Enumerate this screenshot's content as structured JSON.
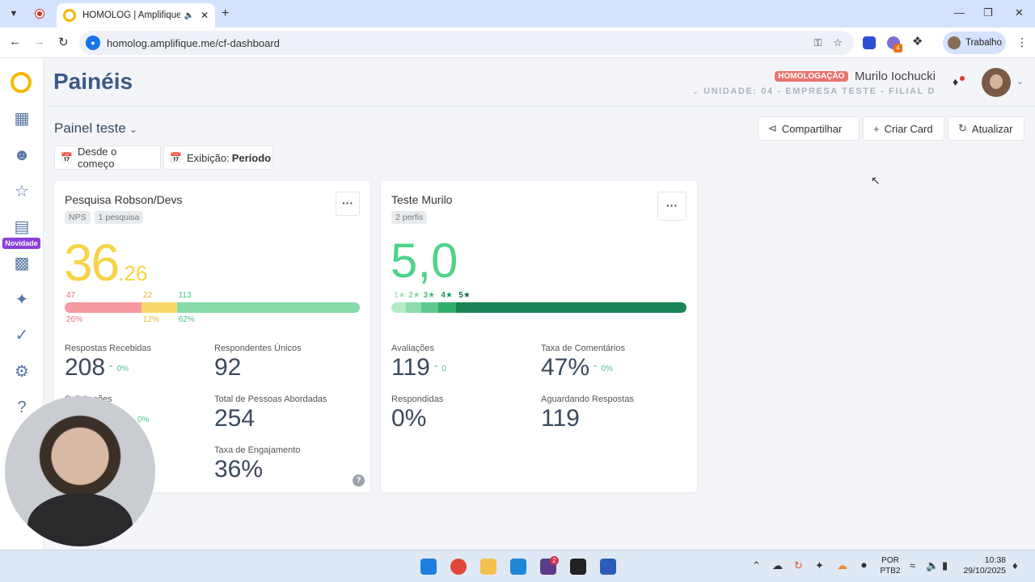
{
  "browser": {
    "tab_title": "HOMOLOG | Amplifique.me",
    "url": "homolog.amplifique.me/cf-dashboard",
    "profile_label": "Trabalho",
    "extension_badge": "4"
  },
  "sidebar": {
    "novidade_label": "Novidade"
  },
  "header": {
    "title": "Painéis",
    "env_badge": "HOMOLOGAÇÃO",
    "user_name": "Murilo Iochucki",
    "unit": "UNIDADE: 04 - EMPRESA TESTE - FILIAL D"
  },
  "panel": {
    "name": "Painel teste",
    "share_label": "Compartilhar",
    "create_label": "Criar Card",
    "refresh_label": "Atualizar",
    "filter_period": "Desde o começo",
    "filter_view_prefix": "Exibição:",
    "filter_view_value": "Período"
  },
  "cards": {
    "nps": {
      "title": "Pesquisa Robson/Devs",
      "tags": [
        "NPS",
        "1 pesquisa"
      ],
      "score_int": "36",
      "score_dec": ".26",
      "segments": [
        {
          "count": "47",
          "pct": "26%",
          "fraction": 0.26,
          "color": "#f59aa0",
          "label_color": "#e57379"
        },
        {
          "count": "22",
          "pct": "12%",
          "fraction": 0.12,
          "color": "#f8d96b",
          "label_color": "#e0b82c"
        },
        {
          "count": "113",
          "pct": "62%",
          "fraction": 0.62,
          "color": "#86dba8",
          "label_color": "#4fc38a"
        }
      ],
      "metrics": {
        "received_label": "Respostas Recebidas",
        "received_value": "208",
        "received_delta": "0%",
        "unique_label": "Respondentes Únicos",
        "unique_value": "92",
        "requests_label": "Solicitações",
        "requests_delta": "0%",
        "approached_label": "Total de Pessoas Abordadas",
        "approached_value": "254",
        "engagement_label": "Taxa de Engajamento",
        "engagement_value": "36%"
      },
      "help": "?"
    },
    "rating": {
      "title": "Teste Murilo",
      "tags": [
        "2 perfis"
      ],
      "average": "5,0",
      "stars": [
        {
          "label": "1★",
          "fraction": 0.05,
          "color": "#b4ecc9",
          "label_color": "#a8e0bd"
        },
        {
          "label": "2★",
          "fraction": 0.05,
          "color": "#8cdcaf",
          "label_color": "#84d3a7"
        },
        {
          "label": "3★",
          "fraction": 0.06,
          "color": "#5ec98f",
          "label_color": "#49ba7d"
        },
        {
          "label": "4★",
          "fraction": 0.06,
          "color": "#2fae6c",
          "label_color": "#229a5c"
        },
        {
          "label": "5★",
          "fraction": 0.78,
          "color": "#198556",
          "label_color": "#146b45"
        }
      ],
      "metrics": {
        "ratings_label": "Avaliações",
        "ratings_value": "119",
        "ratings_delta": "0",
        "comments_label": "Taxa de Comentários",
        "comments_value": "47%",
        "comments_delta": "0%",
        "answered_label": "Respondidas",
        "answered_value": "0%",
        "waiting_label": "Aguardando Respostas",
        "waiting_value": "119"
      }
    }
  },
  "taskbar": {
    "slack_badge": "2",
    "lang_top": "POR",
    "lang_bottom": "PTB2",
    "time": "10:38",
    "date": "29/10/2025"
  }
}
